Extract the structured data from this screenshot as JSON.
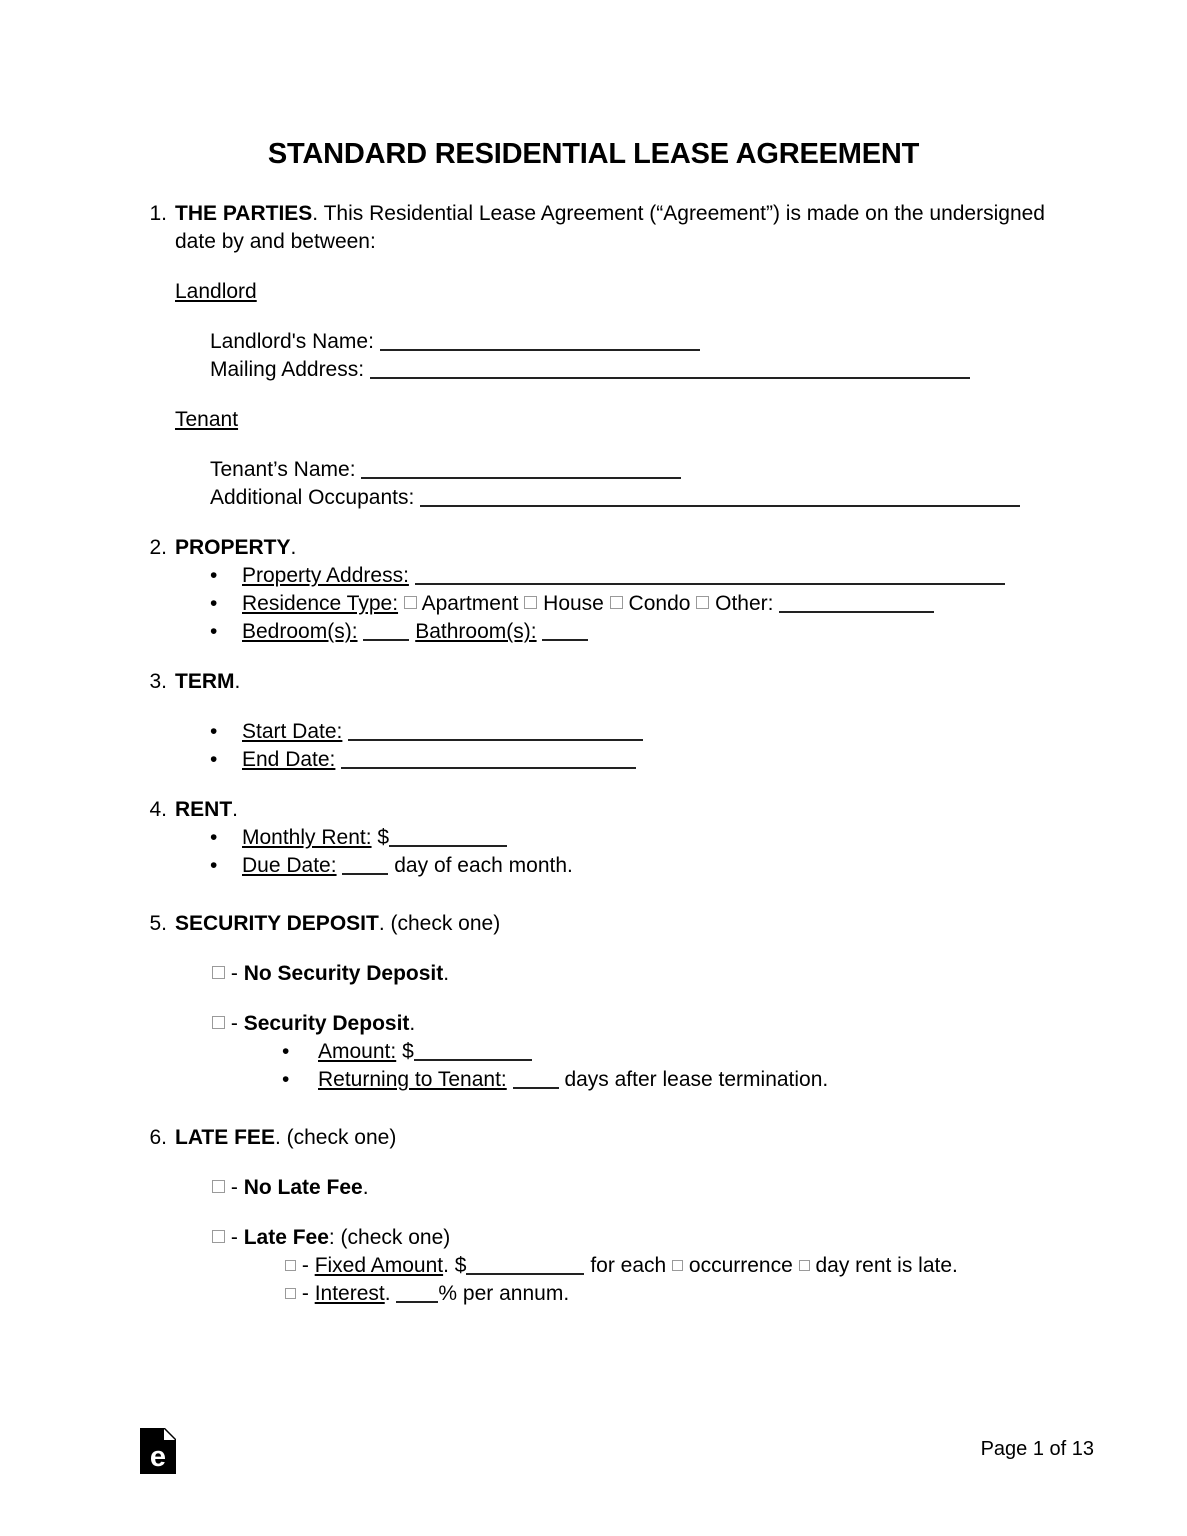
{
  "document": {
    "title": "STANDARD RESIDENTIAL LEASE AGREEMENT"
  },
  "sections": [
    {
      "number": "1.",
      "heading": "THE PARTIES",
      "heading_rest": ". This Residential Lease Agreement (“Agreement”) is made on the undersigned date by and between:",
      "landlord": {
        "group_label": "Landlord",
        "name_label": "Landlord's Name:",
        "address_label": "Mailing Address:"
      },
      "tenant": {
        "group_label": "Tenant",
        "name_label": "Tenant’s Name:",
        "occupants_label": "Additional Occupants:"
      }
    },
    {
      "number": "2.",
      "heading": "PROPERTY",
      "heading_rest": ".",
      "property_address_label": "Property Address:",
      "residence_type_label": "Residence Type:",
      "residence_options": [
        "Apartment",
        "House",
        "Condo"
      ],
      "residence_other_label": "Other:",
      "bedrooms_label": "Bedroom(s):",
      "bathrooms_label": "Bathroom(s):"
    },
    {
      "number": "3.",
      "heading": "TERM",
      "heading_rest": ".",
      "start_date_label": "Start Date:",
      "end_date_label": "End Date:"
    },
    {
      "number": "4.",
      "heading": "RENT",
      "heading_rest": ".",
      "monthly_rent_label": "Monthly Rent:",
      "monthly_rent_currency": "$",
      "due_date_label": "Due Date:",
      "due_date_suffix": "day of each month."
    },
    {
      "number": "5.",
      "heading": "SECURITY DEPOSIT",
      "heading_rest": ". (check one)",
      "option_none_dash": "-",
      "option_none_label": "No Security Deposit",
      "option_none_period": ".",
      "option_yes_dash": "-",
      "option_yes_label": "Security Deposit",
      "option_yes_period": ".",
      "amount_label": "Amount:",
      "amount_currency": "$",
      "returning_label": "Returning to Tenant:",
      "returning_suffix": "days after lease termination."
    },
    {
      "number": "6.",
      "heading": "LATE FEE",
      "heading_rest": ". (check one)",
      "option_none_dash": "-",
      "option_none_label": "No Late Fee",
      "option_none_period": ".",
      "option_yes_dash": "-",
      "option_yes_label": "Late Fee",
      "option_yes_suffix": ": (check one)",
      "fixed_dash": "-",
      "fixed_label": "Fixed Amount",
      "fixed_period": ".",
      "fixed_currency": "$",
      "fixed_for_each": "for each",
      "fixed_opt_occurrence": "occurrence",
      "fixed_opt_day": "day rent is late.",
      "interest_dash": "-",
      "interest_label": "Interest",
      "interest_period": ".",
      "interest_suffix": "% per annum."
    }
  ],
  "footer": {
    "logo_name": "eforms-logo",
    "logo_letter": "e",
    "page_number": "Page 1 of 13"
  }
}
